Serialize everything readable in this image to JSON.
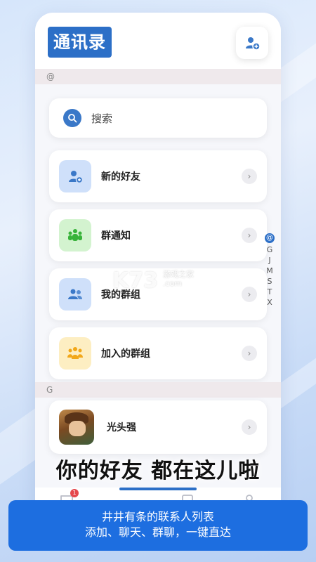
{
  "header": {
    "title": "通讯录",
    "add_contact_icon": "person-add-icon"
  },
  "sections": {
    "at_label": "@",
    "g_label": "G"
  },
  "search": {
    "placeholder": "搜索",
    "icon": "search-icon"
  },
  "menu": [
    {
      "label": "新的好友",
      "icon": "person-add-icon",
      "color": "#cfe0fa",
      "icon_color": "#3a78c8"
    },
    {
      "label": "群通知",
      "icon": "group-notice-icon",
      "color": "#d3f3cf",
      "icon_color": "#38b33a"
    },
    {
      "label": "我的群组",
      "icon": "my-groups-icon",
      "color": "#cfe0fa",
      "icon_color": "#3a78c8"
    },
    {
      "label": "加入的群组",
      "icon": "joined-groups-icon",
      "color": "#fdeec2",
      "icon_color": "#f2a719"
    }
  ],
  "contacts": [
    {
      "name": "光头强",
      "avatar": "avatar"
    }
  ],
  "az_index": [
    "@",
    "G",
    "J",
    "M",
    "S",
    "T",
    "X"
  ],
  "watermark": {
    "logo": "K73",
    "line1": "游戏之家",
    "line2": ".com"
  },
  "tabbar": {
    "badge_count": "1",
    "tabs": [
      "chat-icon",
      "contacts-icon",
      "discover-icon",
      "profile-icon"
    ]
  },
  "slogan": "你的好友 都在这儿啦",
  "promo": {
    "line1": "井井有条的联系人列表",
    "line2": "添加、聊天、群聊，一键直达"
  },
  "colors": {
    "accent": "#2c6fc7",
    "promo_bg": "#1d6ee0"
  }
}
